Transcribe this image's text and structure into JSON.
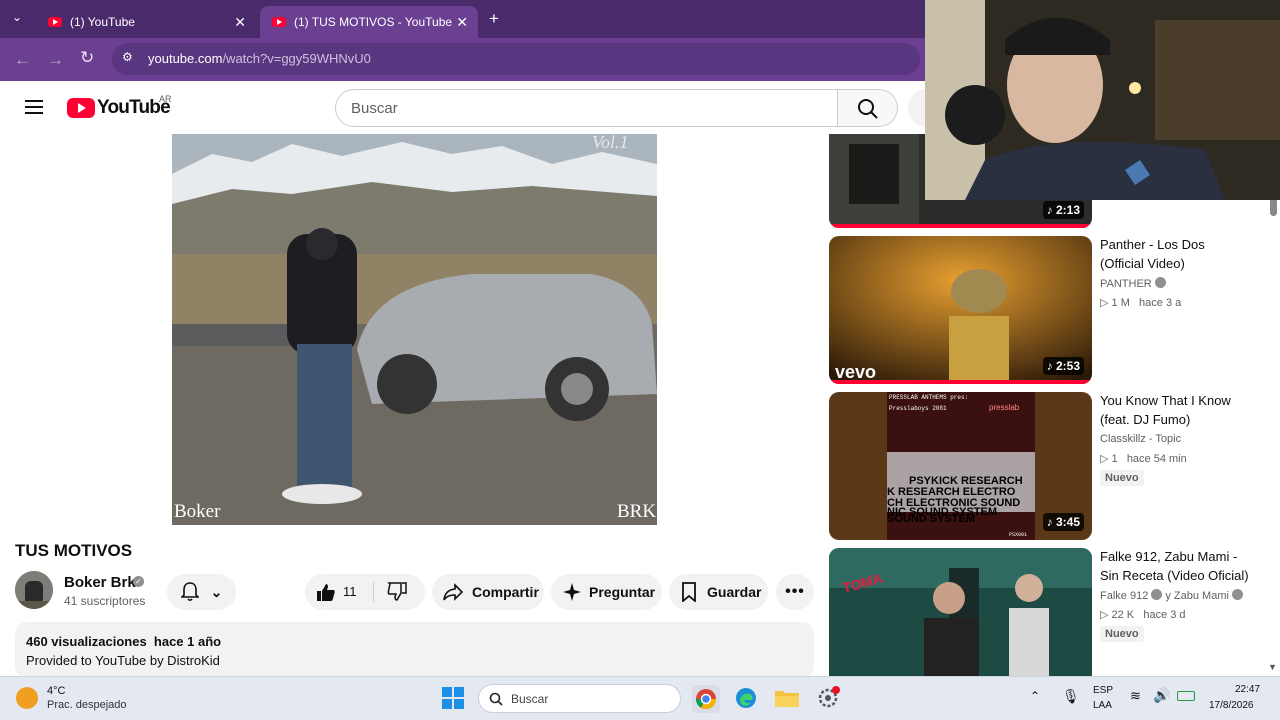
{
  "browser": {
    "tabs": [
      {
        "label": "(1) YouTube",
        "active": false
      },
      {
        "label": "(1) TUS MOTIVOS - YouTube",
        "active": true
      }
    ],
    "url_host": "youtube.com",
    "url_path": "/watch?v=ggy59WHNvU0"
  },
  "youtube": {
    "logo_text": "YouTube",
    "country": "AR",
    "search_placeholder": "Buscar"
  },
  "video": {
    "cover_left_text": "Boker",
    "cover_right_text": "BRK",
    "cover_top_text": "Vol.1",
    "title": "TUS MOTIVOS",
    "channel": "Boker Brk",
    "subscribers": "41 suscriptores",
    "likes": "11",
    "share_label": "Compartir",
    "ask_label": "Preguntar",
    "save_label": "Guardar",
    "views_line": "460 visualizaciones  hace 1 año",
    "desc_line": "Provided to YouTube by DistroKid"
  },
  "related": [
    {
      "duration": "2:13"
    },
    {
      "title": "Panther - Los Dos (Official Video)",
      "channel": "PANTHER",
      "views": "1 M",
      "age": "hace 3 a",
      "duration": "2:53",
      "thumb_text": "vevo"
    },
    {
      "title": "You Know That I Know (feat. DJ Fumo)",
      "channel": "Classkillz - Topic",
      "views": "1",
      "age": "hace 54 min",
      "badge": "Nuevo",
      "duration": "3:45",
      "thumb_lines": [
        "PSYKICK RESEARCH",
        "K RESEARCH ELECTRO",
        "CH ELECTRONIC SOUND",
        "NIC SOUND SYSTEM",
        "SOUND SYSTEM"
      ],
      "thumb_header": "PRESSLAB ANTHEMS pres:",
      "thumb_sub": "Presslaboys 2081",
      "thumb_corner": "PSX001",
      "thumb_logo": "presslab"
    },
    {
      "title": "Falke 912, Zabu Mami - Sin Receta (Video Oficial)",
      "channel": "Falke 912",
      "channel2": "y Zabu Mami",
      "views": "22 K",
      "age": "hace 3 d",
      "badge": "Nuevo"
    }
  ],
  "taskbar": {
    "weather_temp": "4°C",
    "weather_desc": "Prac. despejado",
    "search_label": "Buscar",
    "lang1": "ESP",
    "lang2": "LAA",
    "time": "22:47",
    "date": "17/8/2026"
  },
  "colors": {
    "tabbar": "#4a2a6b",
    "addressbar": "#6b3f92",
    "yt_red": "#ff0033"
  }
}
